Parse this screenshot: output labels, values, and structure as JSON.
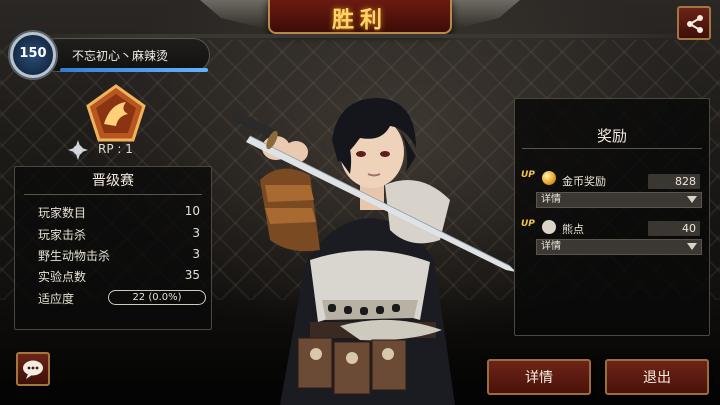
{
  "header": {
    "title": "胜利"
  },
  "player": {
    "level": "150",
    "name": "不忘初心丶麻辣烫",
    "xp_fraction": 1.0
  },
  "rank": {
    "rp_label": "RP : 1"
  },
  "stats": {
    "title": "晋级赛",
    "rows": [
      {
        "label": "玩家数目",
        "value": "10"
      },
      {
        "label": "玩家击杀",
        "value": "3"
      },
      {
        "label": "野生动物击杀",
        "value": "3"
      },
      {
        "label": "实验点数",
        "value": "35"
      }
    ],
    "fitness": {
      "label": "适应度",
      "value": "22 (0.0%)"
    }
  },
  "rewards": {
    "title": "奖励",
    "items": [
      {
        "up": "UP",
        "icon": "coin-icon",
        "label": "金币奖励",
        "value": "828",
        "select": "详情"
      },
      {
        "up": "UP",
        "icon": "bear-icon",
        "label": "熊点",
        "value": "40",
        "select": "详情"
      }
    ]
  },
  "buttons": {
    "details": "详情",
    "exit": "退出"
  },
  "icons": {
    "share": "share-icon",
    "chat": "chat-bubble-icon",
    "rank": "phoenix-rank-emblem-icon"
  },
  "colors": {
    "accent_red": "#6e2317",
    "gold": "#ffd56a",
    "border_gold": "#9c6d3c"
  }
}
